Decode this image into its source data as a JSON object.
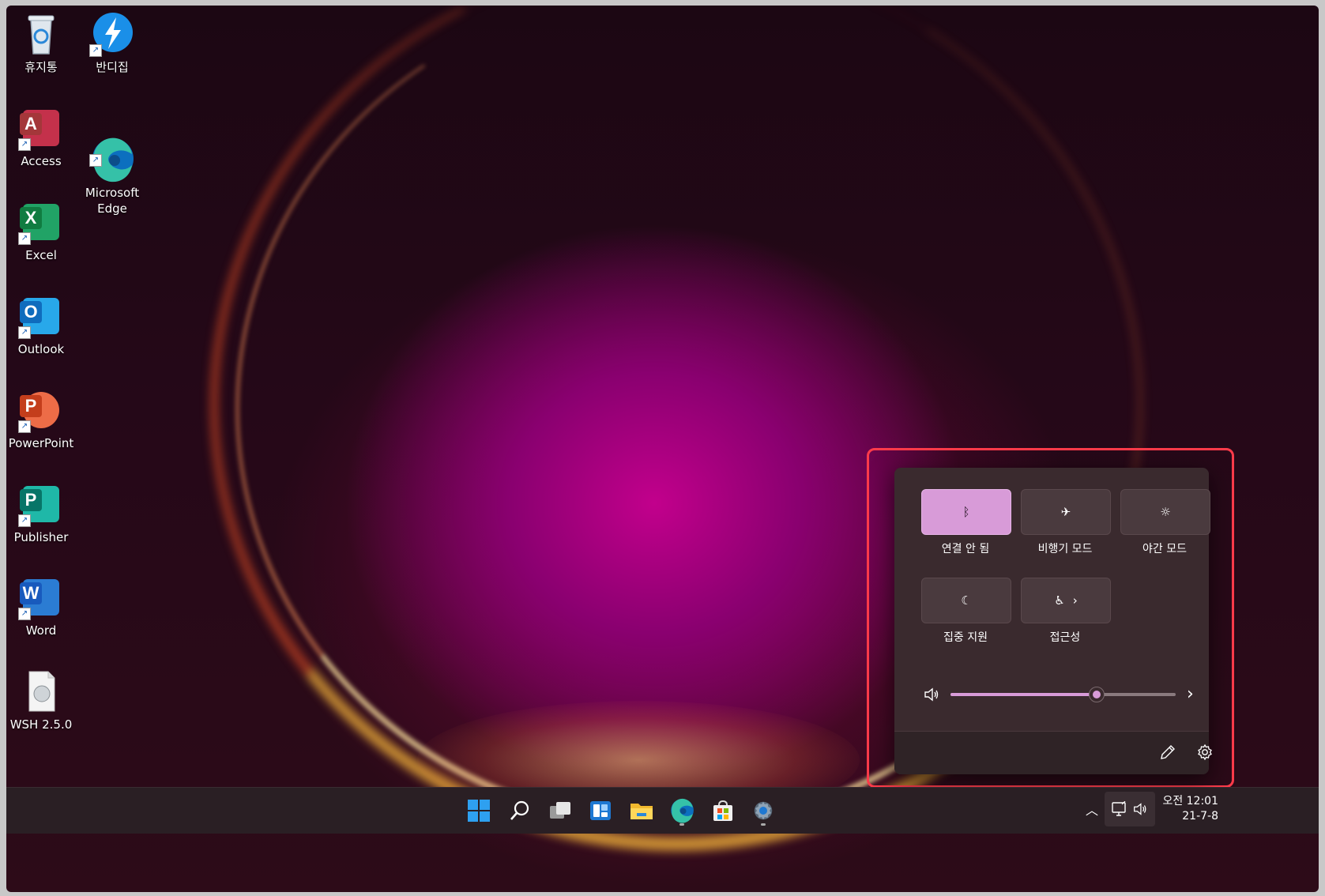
{
  "desktop": {
    "icons": [
      {
        "label": "휴지통",
        "icon": "recycle-bin-icon"
      },
      {
        "label": "반디집",
        "icon": "bandizip-icon"
      },
      {
        "label": "Access",
        "icon": "access-icon",
        "letter": "A",
        "color": "#a4373a"
      },
      {
        "label": "Microsoft\nEdge",
        "icon": "edge-icon"
      },
      {
        "label": "Excel",
        "icon": "excel-icon",
        "letter": "X",
        "color": "#107c41"
      },
      {
        "label": "Outlook",
        "icon": "outlook-icon",
        "letter": "O",
        "color": "#0f6cbd"
      },
      {
        "label": "PowerPoint",
        "icon": "powerpoint-icon",
        "letter": "P",
        "color": "#c43e1c"
      },
      {
        "label": "Publisher",
        "icon": "publisher-icon",
        "letter": "P",
        "color": "#077568"
      },
      {
        "label": "Word",
        "icon": "word-icon",
        "letter": "W",
        "color": "#185abd"
      },
      {
        "label": "WSH 2.5.0",
        "icon": "wsh-file-icon"
      }
    ]
  },
  "quick_settings": {
    "tiles": [
      {
        "label": "연결 안 됨",
        "icon": "bluetooth-icon",
        "glyph": "ᛒ",
        "active": true
      },
      {
        "label": "비행기 모드",
        "icon": "airplane-icon",
        "glyph": "✈",
        "active": false
      },
      {
        "label": "야간 모드",
        "icon": "night-light-icon",
        "glyph": "☼",
        "active": false
      },
      {
        "label": "집중 지원",
        "icon": "focus-assist-moon-icon",
        "glyph": "☾",
        "active": false
      },
      {
        "label": "접근성",
        "icon": "accessibility-icon",
        "glyph": "♿",
        "active": false
      }
    ],
    "volume": {
      "level": 0.65,
      "icon": "speaker-icon"
    },
    "accent": "#d89bd8"
  },
  "taskbar": {
    "clock": {
      "period": "오전 12:01",
      "date": "21-7-8"
    }
  }
}
